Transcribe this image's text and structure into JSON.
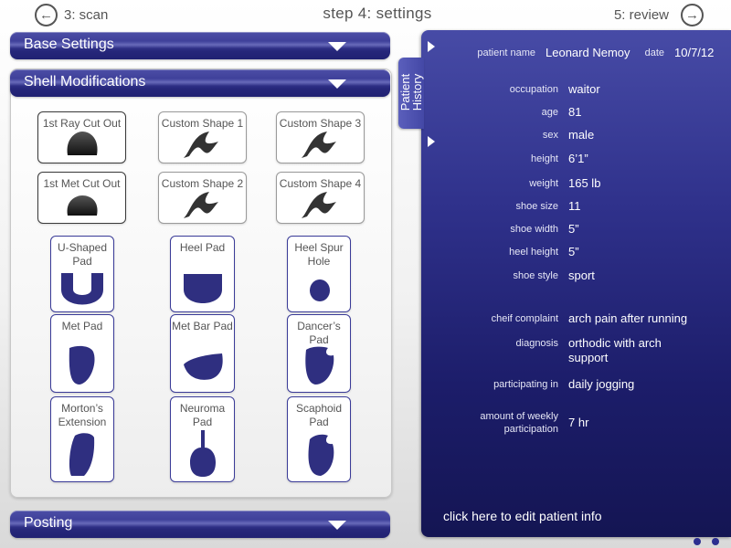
{
  "nav": {
    "back_label": "3: scan",
    "title": "step 4: settings",
    "next_label": "5: review"
  },
  "sections": {
    "base_settings": "Base Settings",
    "shell_modifications": "Shell Modifications",
    "posting": "Posting"
  },
  "shell_items": [
    {
      "label": "1st Ray Cut Out",
      "shape": "dome-shape"
    },
    {
      "label": "Custom Shape 1",
      "shape": "wave-shape"
    },
    {
      "label": "Custom Shape 3",
      "shape": "wave-shape"
    },
    {
      "label": "1st Met Cut Out",
      "shape": "dome-shape"
    },
    {
      "label": "Custom Shape 2",
      "shape": "wave-shape"
    },
    {
      "label": "Custom Shape 4",
      "shape": "wave-shape"
    },
    {
      "label": "U-Shaped Pad",
      "shape": "u-shape"
    },
    {
      "label": "Heel Pad",
      "shape": "heel-pad-shape"
    },
    {
      "label": "Heel Spur Hole",
      "shape": "circle-shape"
    },
    {
      "label": "Met Pad",
      "shape": "teardrop-shape"
    },
    {
      "label": "Met Bar Pad",
      "shape": "bar-shape"
    },
    {
      "label": "Dancer’s Pad",
      "shape": "notched-pad-shape"
    },
    {
      "label": "Morton’s Extension",
      "shape": "extension-shape"
    },
    {
      "label": "Neuroma Pad",
      "shape": "neuroma-shape"
    },
    {
      "label": "Scaphoid Pad",
      "shape": "scaphoid-shape"
    }
  ],
  "patient_tab_label": "Patient History",
  "patient": {
    "name_label": "patient name",
    "name": "Leonard Nemoy",
    "date_label": "date",
    "date": "10/7/12",
    "fields": [
      {
        "label": "occupation",
        "value": "waitor"
      },
      {
        "label": "age",
        "value": "81"
      },
      {
        "label": "sex",
        "value": "male"
      },
      {
        "label": "height",
        "value": "6’1”"
      },
      {
        "label": "weight",
        "value": "165 lb"
      },
      {
        "label": "shoe size",
        "value": "11"
      },
      {
        "label": "shoe width",
        "value": "5”"
      },
      {
        "label": "heel height",
        "value": "5”"
      },
      {
        "label": "shoe style",
        "value": "sport"
      },
      {
        "label": "cheif complaint",
        "value": "arch pain after running"
      },
      {
        "label": "diagnosis",
        "value": "orthodic with arch support"
      },
      {
        "label": "participating in",
        "value": "daily jogging"
      },
      {
        "label": "amount of weekly participation",
        "value": "7 hr"
      }
    ],
    "edit_link": "click here to edit patient info"
  },
  "colors": {
    "accent": "#2f318b",
    "header_bar": "#3b3c96",
    "shape_fill": "#2f2f80"
  }
}
